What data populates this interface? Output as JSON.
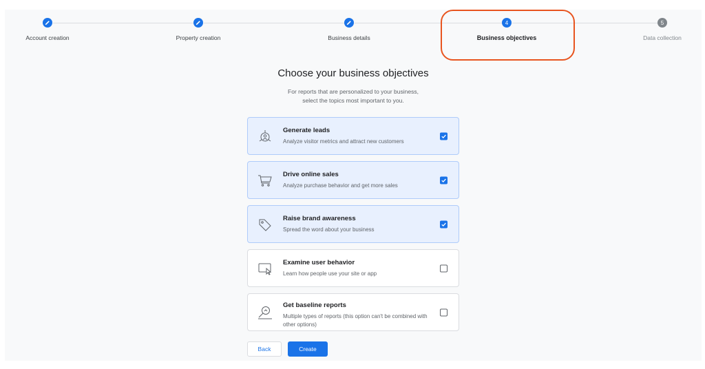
{
  "stepper": {
    "steps": [
      {
        "label": "Account creation",
        "status": "done",
        "icon": "pencil-icon"
      },
      {
        "label": "Property creation",
        "status": "done",
        "icon": "pencil-icon"
      },
      {
        "label": "Business details",
        "status": "done",
        "icon": "pencil-icon"
      },
      {
        "label": "Business objectives",
        "status": "active",
        "number": "4"
      },
      {
        "label": "Data collection",
        "status": "pending",
        "number": "5"
      }
    ],
    "annotation_color": "#e8541e"
  },
  "page": {
    "title": "Choose your business objectives",
    "subtitle_line1": "For reports that are personalized to your business,",
    "subtitle_line2": "select the topics most important to you."
  },
  "options": [
    {
      "title": "Generate leads",
      "desc": "Analyze visitor metrics and attract new customers",
      "checked": true,
      "icon": "leads-target-icon"
    },
    {
      "title": "Drive online sales",
      "desc": "Analyze purchase behavior and get more sales",
      "checked": true,
      "icon": "shopping-cart-icon"
    },
    {
      "title": "Raise brand awareness",
      "desc": "Spread the word about your business",
      "checked": true,
      "icon": "tag-icon"
    },
    {
      "title": "Examine user behavior",
      "desc": "Learn how people use your site or app",
      "checked": false,
      "icon": "screen-cursor-icon"
    },
    {
      "title": "Get baseline reports",
      "desc": "Multiple types of reports (this option can't be combined with other options)",
      "checked": false,
      "icon": "magnifier-report-icon"
    }
  ],
  "buttons": {
    "back": "Back",
    "create": "Create"
  },
  "colors": {
    "primary": "#1a73e8",
    "selected_bg": "#e8f0fe",
    "pending": "#80868b"
  }
}
